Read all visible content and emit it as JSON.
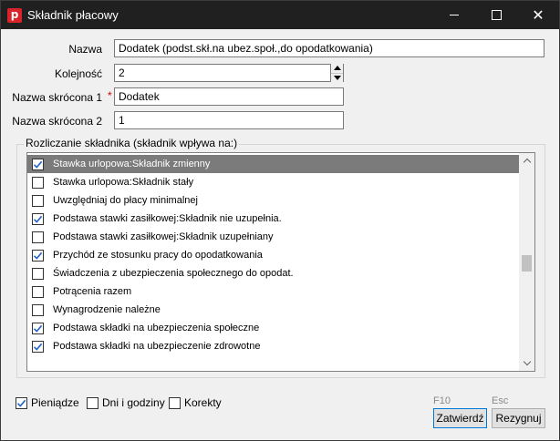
{
  "window": {
    "title": "Składnik płacowy",
    "app_icon_letter": "p",
    "minimize_label": "—",
    "maximize_label": "☐",
    "close_label": "✕"
  },
  "form": {
    "name": {
      "label": "Nazwa",
      "value": "Dodatek (podst.skł.na ubez.społ.,do opodatkowania)"
    },
    "order": {
      "label": "Kolejność",
      "value": "2"
    },
    "short1": {
      "label": "Nazwa skrócona 1",
      "required_mark": "*",
      "value": "Dodatek"
    },
    "short2": {
      "label": "Nazwa skrócona 2",
      "value": "1"
    }
  },
  "settlement": {
    "title": "Rozliczanie składnika (składnik wpływa na:)",
    "items": [
      {
        "label": "Stawka urlopowa:Składnik zmienny",
        "checked": true,
        "selected": true
      },
      {
        "label": "Stawka urlopowa:Składnik stały",
        "checked": false,
        "selected": false
      },
      {
        "label": "Uwzględniaj do płacy minimalnej",
        "checked": false,
        "selected": false
      },
      {
        "label": "Podstawa stawki zasiłkowej:Składnik nie uzupełnia.",
        "checked": true,
        "selected": false
      },
      {
        "label": "Podstawa stawki zasiłkowej:Składnik uzupełniany",
        "checked": false,
        "selected": false
      },
      {
        "label": "Przychód ze stosunku pracy do opodatkowania",
        "checked": true,
        "selected": false
      },
      {
        "label": "Świadczenia z ubezpieczenia społecznego do opodat.",
        "checked": false,
        "selected": false
      },
      {
        "label": "Potrącenia razem",
        "checked": false,
        "selected": false
      },
      {
        "label": "Wynagrodzenie należne",
        "checked": false,
        "selected": false
      },
      {
        "label": "Podstawa składki na ubezpieczenia społeczne",
        "checked": true,
        "selected": false
      },
      {
        "label": "Podstawa składki na ubezpieczenie zdrowotne",
        "checked": true,
        "selected": false
      }
    ]
  },
  "footer": {
    "money": {
      "label": "Pieniądze",
      "checked": true
    },
    "days_hours": {
      "label": "Dni i godziny",
      "checked": false
    },
    "corrections": {
      "label": "Korekty",
      "checked": false
    },
    "confirm": {
      "hint": "F10",
      "label": "Zatwierdź"
    },
    "cancel": {
      "hint": "Esc",
      "label": "Rezygnuj"
    }
  },
  "colors": {
    "titlebar": "#202020",
    "check": "#1e62c9",
    "selected_row": "#7b7b7b",
    "required": "#d00000"
  }
}
